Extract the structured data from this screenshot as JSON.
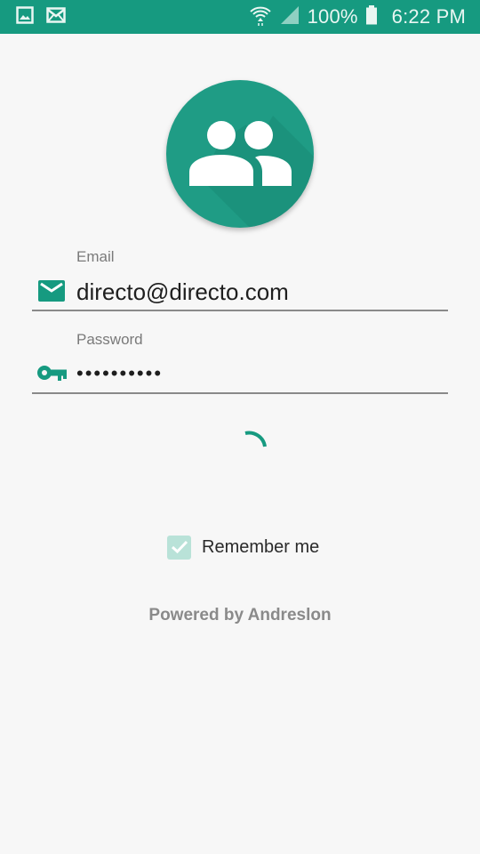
{
  "status_bar": {
    "icons_left": [
      "image-icon",
      "mail-icon"
    ],
    "icons_right": [
      "wifi-icon",
      "signal-icon",
      "battery-icon"
    ],
    "battery": "100%",
    "time": "6:22 PM"
  },
  "avatar": {
    "icon": "people-group-icon",
    "color": "#1f9c85"
  },
  "form": {
    "email": {
      "label": "Email",
      "value": "directo@directo.com",
      "icon": "mail-icon"
    },
    "password": {
      "label": "Password",
      "value": "••••••••••",
      "icon": "key-icon"
    }
  },
  "loading": {
    "icon": "spinner-icon"
  },
  "remember": {
    "label": "Remember me",
    "checked": true
  },
  "footer": {
    "powered_by": "Powered by Andreslon"
  },
  "colors": {
    "accent": "#169a80",
    "status_bar": "#169a80",
    "checkbox": "#b9e2d8"
  }
}
